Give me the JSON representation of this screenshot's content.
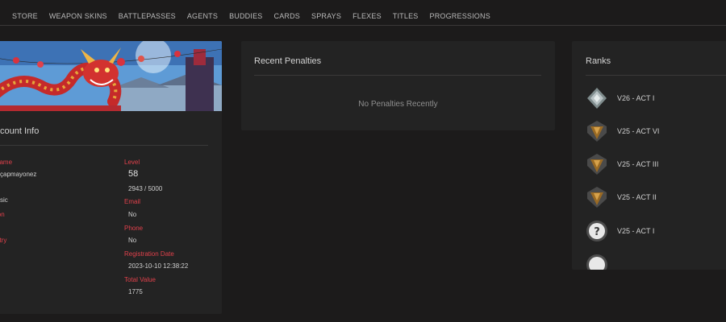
{
  "nav": {
    "items": [
      "STORE",
      "WEAPON SKINS",
      "BATTLEPASSES",
      "AGENTS",
      "BUDDIES",
      "CARDS",
      "SPRAYS",
      "FLEXES",
      "TITLES",
      "PROGRESSIONS"
    ]
  },
  "account": {
    "title": "count Info",
    "fields_left": [
      {
        "label": "name",
        "value": "çapmayonez"
      },
      {
        "label": "",
        "value": "sic"
      },
      {
        "label": "ion",
        "value": ""
      },
      {
        "label": "ntry",
        "value": ""
      }
    ],
    "level": {
      "label": "Level",
      "value": "58",
      "progress": "2943 / 5000"
    },
    "email": {
      "label": "Email",
      "value": "No"
    },
    "phone": {
      "label": "Phone",
      "value": "No"
    },
    "registration": {
      "label": "Registration Date",
      "value": "2023-10-10 12:38:22"
    },
    "total_value": {
      "label": "Total Value",
      "value": "1775"
    }
  },
  "penalties": {
    "title": "Recent Penalties",
    "empty_message": "No Penalties Recently"
  },
  "ranks": {
    "title": "Ranks",
    "items": [
      {
        "label": "V26 - ACT I",
        "icon": "iron-rank-icon"
      },
      {
        "label": "V25 - ACT VI",
        "icon": "bronze-rank-icon"
      },
      {
        "label": "V25 - ACT III",
        "icon": "bronze-rank-icon"
      },
      {
        "label": "V25 - ACT II",
        "icon": "bronze-rank-icon"
      },
      {
        "label": "V25 - ACT I",
        "icon": "unranked-icon"
      }
    ]
  },
  "colors": {
    "background": "#1c1b1b",
    "panel": "#232323",
    "label_red": "#e0414b"
  }
}
